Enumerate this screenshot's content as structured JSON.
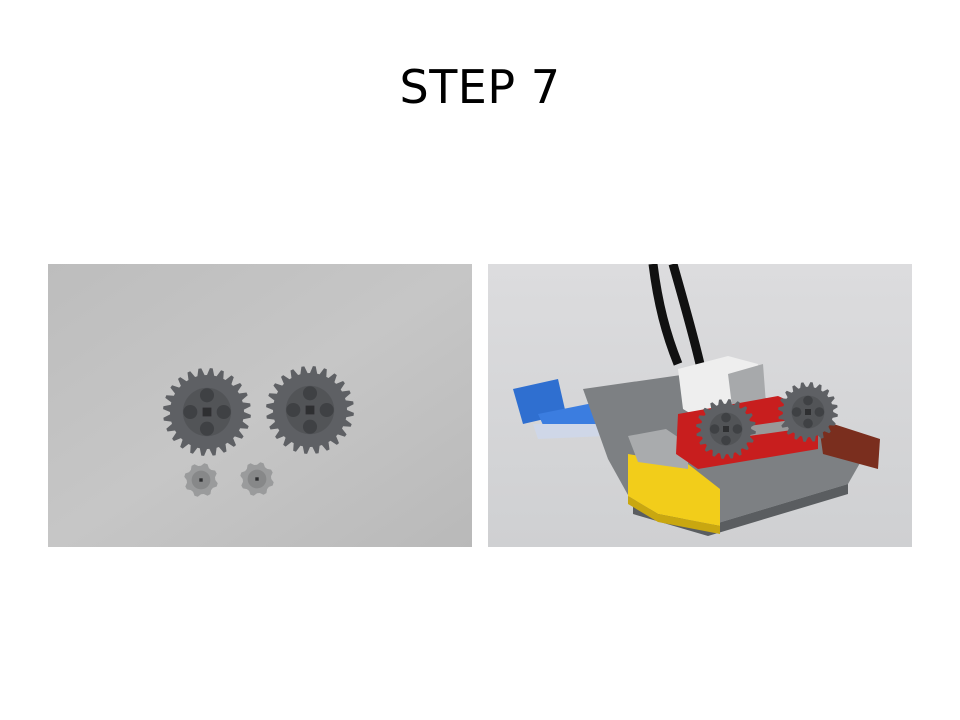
{
  "slide": {
    "title": "STEP 7",
    "photos": [
      {
        "name": "gears-parts-photo",
        "depicts": [
          "gear-24-tooth",
          "gear-24-tooth",
          "gear-8-tooth",
          "gear-8-tooth"
        ]
      },
      {
        "name": "assembled-model-photo",
        "depicts": [
          "lego-baseplate",
          "motor",
          "red-gear-frame",
          "gear-24-tooth",
          "gear-24-tooth",
          "cable"
        ]
      }
    ],
    "colors": {
      "background": "#ffffff",
      "photo_bg_left": "#c2c2c2",
      "photo_bg_right": "#d6d6d8",
      "gear_dark": "#5e6064",
      "gear_light": "#9a9b9c",
      "plate_gray": "#7d8083",
      "brick_red": "#c81e1e",
      "brick_yellow": "#f2cd1a",
      "brick_blue": "#2f6fd0",
      "brick_brown": "#7a2e1e"
    }
  }
}
